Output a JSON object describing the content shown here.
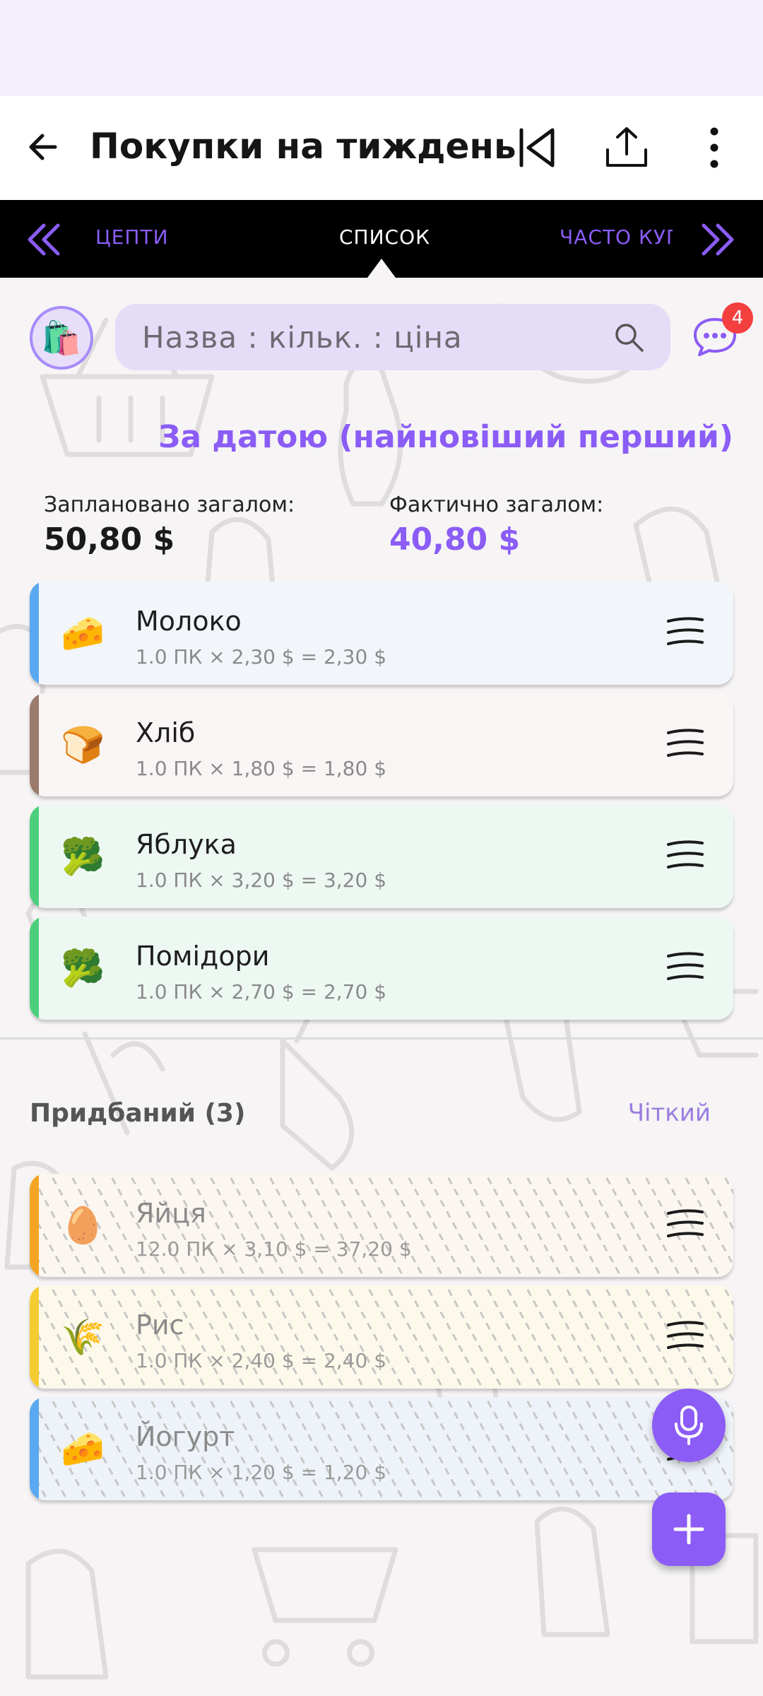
{
  "app_bar": {
    "title": "Покупки на тиждень",
    "icons": [
      "back-arrow-icon",
      "skip-start-icon",
      "share-icon",
      "more-vert-icon"
    ]
  },
  "tabs": {
    "left": "ЦЕПТИ",
    "center": "СПИСОК",
    "right": "ЧАСТО КУП"
  },
  "search": {
    "placeholder": "Назва : кільк. : ціна"
  },
  "chat": {
    "badge": "4"
  },
  "sort_label": "За датою (найновіший перший)",
  "totals": {
    "planned_label": "Заплановано загалом:",
    "planned_value": "50,80 $",
    "actual_label": "Фактично загалом:",
    "actual_value": "40,80 $"
  },
  "active_items": [
    {
      "emoji": "🧀",
      "name": "Молоко",
      "detail": "1.0 ПК × 2,30 $ = 2,30 $",
      "color": "#5aa9f0",
      "bg": "#f2f6fb"
    },
    {
      "emoji": "🍞",
      "name": "Хліб",
      "detail": "1.0 ПК × 1,80 $ = 1,80 $",
      "color": "#9b7b6c",
      "bg": "#f8f5f4"
    },
    {
      "emoji": "🥦",
      "name": "Яблука",
      "detail": "1.0 ПК × 3,20 $ = 3,20 $",
      "color": "#4ccf7c",
      "bg": "#eef8f2"
    },
    {
      "emoji": "🥦",
      "name": "Помідори",
      "detail": "1.0 ПК × 2,70 $ = 2,70 $",
      "color": "#4ccf7c",
      "bg": "#eef8f2"
    }
  ],
  "bought_section": {
    "header": "Придбаний (3)",
    "clear_label": "Чіткий"
  },
  "bought_items": [
    {
      "emoji": "🥚",
      "name": "Яйця",
      "detail": "12.0 ПК × 3,10 $ = 37,20 $",
      "color": "#f5a524",
      "bg": "#fbf6ef"
    },
    {
      "emoji": "🌾",
      "name": "Рис",
      "detail": "1.0 ПК × 2,40 $ = 2,40 $",
      "color": "#f5cc30",
      "bg": "#fcf9ea"
    },
    {
      "emoji": "🧀",
      "name": "Йогурт",
      "detail": "1.0 ПК × 1,20 $ = 1,20 $",
      "color": "#5aa9f0",
      "bg": "#eef3f9"
    }
  ],
  "colors": {
    "accent": "#8b5cf6",
    "badge": "#f43f3f"
  }
}
